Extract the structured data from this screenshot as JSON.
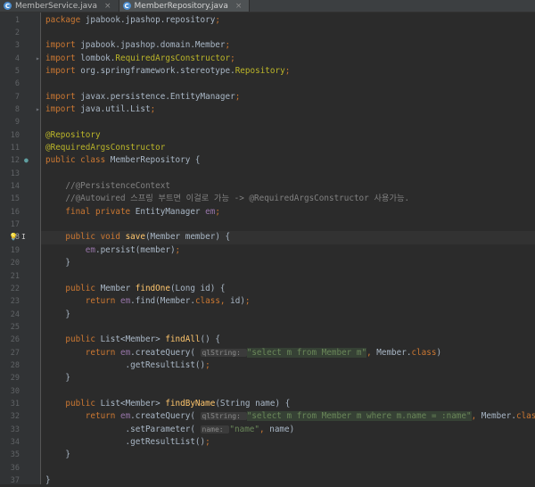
{
  "tabs": [
    {
      "label": "MemberService.java",
      "icon": "class-icon",
      "active": false
    },
    {
      "label": "MemberRepository.java",
      "icon": "class-icon",
      "active": true
    }
  ],
  "tab_close_glyph": "×",
  "class_glyph": "C",
  "current_line": 18,
  "colors": {
    "keyword": "#cc7832",
    "annotation": "#bbb529",
    "string": "#6a8759",
    "field": "#9876aa",
    "method": "#ffc66d",
    "comment": "#808080",
    "background": "#2b2b2b"
  },
  "lines": [
    [
      [
        "k",
        "package "
      ],
      [
        "t",
        "jpabook.jpashop.repository"
      ],
      [
        "k",
        ";"
      ]
    ],
    [],
    [
      [
        "k",
        "import "
      ],
      [
        "t",
        "jpabook.jpashop.domain.Member"
      ],
      [
        "k",
        ";"
      ]
    ],
    [
      [
        "k",
        "import "
      ],
      [
        "t",
        "lombok."
      ],
      [
        "a",
        "RequiredArgsConstructor"
      ],
      [
        "k",
        ";"
      ]
    ],
    [
      [
        "k",
        "import "
      ],
      [
        "t",
        "org.springframework.stereotype."
      ],
      [
        "a",
        "Repository"
      ],
      [
        "k",
        ";"
      ]
    ],
    [],
    [
      [
        "k",
        "import "
      ],
      [
        "t",
        "javax.persistence.EntityManager"
      ],
      [
        "k",
        ";"
      ]
    ],
    [
      [
        "k",
        "import "
      ],
      [
        "t",
        "java.util.List"
      ],
      [
        "k",
        ";"
      ]
    ],
    [],
    [
      [
        "a",
        "@Repository"
      ]
    ],
    [
      [
        "a",
        "@RequiredArgsConstructor"
      ]
    ],
    [
      [
        "k",
        "public class "
      ],
      [
        "t",
        "MemberRepository {"
      ]
    ],
    [],
    [
      [
        "c",
        "    //@PersistenceContext"
      ]
    ],
    [
      [
        "c",
        "    //@Autowired 스프링 부트면 이걸로 가능 -> @RequiredArgsConstructor 사용가능."
      ]
    ],
    [
      [
        "k",
        "    final private "
      ],
      [
        "t",
        "EntityManager "
      ],
      [
        "f",
        "em"
      ],
      [
        "k",
        ";"
      ]
    ],
    [],
    [
      [
        "k",
        "    public void "
      ],
      [
        "m",
        "save"
      ],
      [
        "t",
        "(Member member) {"
      ]
    ],
    [
      [
        "t",
        "        "
      ],
      [
        "f",
        "em"
      ],
      [
        "t",
        ".persist(member)"
      ],
      [
        "k",
        ";"
      ]
    ],
    [
      [
        "t",
        "    }"
      ]
    ],
    [],
    [
      [
        "k",
        "    public "
      ],
      [
        "t",
        "Member "
      ],
      [
        "m",
        "findOne"
      ],
      [
        "t",
        "(Long id) {"
      ]
    ],
    [
      [
        "k",
        "        return "
      ],
      [
        "f",
        "em"
      ],
      [
        "t",
        ".find(Member."
      ],
      [
        "k",
        "class, "
      ],
      [
        "t",
        "id)"
      ],
      [
        "k",
        ";"
      ]
    ],
    [
      [
        "t",
        "    }"
      ]
    ],
    [],
    [
      [
        "k",
        "    public "
      ],
      [
        "t",
        "List<Member> "
      ],
      [
        "m",
        "findAll"
      ],
      [
        "t",
        "() {"
      ]
    ],
    [
      [
        "k",
        "        return "
      ],
      [
        "f",
        "em"
      ],
      [
        "t",
        ".createQuery( "
      ],
      [
        "h",
        "qlString: "
      ],
      [
        "q",
        "\"select m from Member m\""
      ],
      [
        "k",
        ", "
      ],
      [
        "t",
        "Member."
      ],
      [
        "k",
        "class"
      ],
      [
        "t",
        ")"
      ]
    ],
    [
      [
        "t",
        "                .getResultList()"
      ],
      [
        "k",
        ";"
      ]
    ],
    [
      [
        "t",
        "    }"
      ]
    ],
    [],
    [
      [
        "k",
        "    public "
      ],
      [
        "t",
        "List<Member> "
      ],
      [
        "m",
        "findByName"
      ],
      [
        "t",
        "(String name) {"
      ]
    ],
    [
      [
        "k",
        "        return "
      ],
      [
        "f",
        "em"
      ],
      [
        "t",
        ".createQuery( "
      ],
      [
        "h",
        "qlString: "
      ],
      [
        "q",
        "\"select m from Member m where m.name = :name\""
      ],
      [
        "k",
        ", "
      ],
      [
        "t",
        "Member."
      ],
      [
        "k",
        "class"
      ],
      [
        "t",
        ")"
      ]
    ],
    [
      [
        "t",
        "                .setParameter( "
      ],
      [
        "h",
        "name: "
      ],
      [
        "s",
        "\"name\""
      ],
      [
        "k",
        ", "
      ],
      [
        "t",
        "name)"
      ]
    ],
    [
      [
        "t",
        "                .getResultList()"
      ],
      [
        "k",
        ";"
      ]
    ],
    [
      [
        "t",
        "    }"
      ]
    ],
    [],
    [
      [
        "t",
        "}"
      ]
    ]
  ],
  "gutter_marks": {
    "4": "▸",
    "8": "▸",
    "12": "●",
    "18": "I"
  },
  "bulb_glyph": "💡"
}
